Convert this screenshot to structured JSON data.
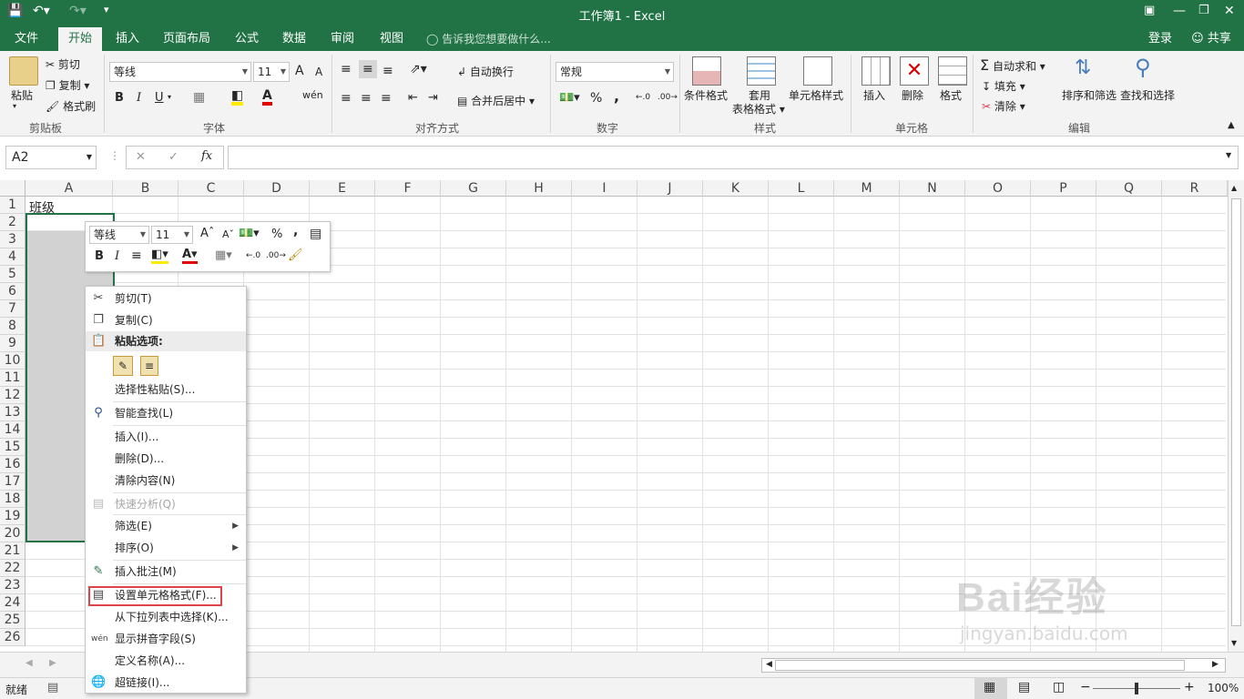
{
  "window": {
    "title": "工作簿1 - Excel"
  },
  "tabs": [
    {
      "label": "文件"
    },
    {
      "label": "开始"
    },
    {
      "label": "插入"
    },
    {
      "label": "页面布局"
    },
    {
      "label": "公式"
    },
    {
      "label": "数据"
    },
    {
      "label": "审阅"
    },
    {
      "label": "视图"
    }
  ],
  "tellme": "告诉我您想要做什么...",
  "login": "登录",
  "share": "共享",
  "ribbon": {
    "clipboard": {
      "paste": "粘贴",
      "cut": "剪切",
      "copy": "复制",
      "format_painter": "格式刷",
      "group": "剪贴板"
    },
    "font": {
      "name": "等线",
      "size": "11",
      "bold": "B",
      "italic": "I",
      "underline": "U",
      "group": "字体",
      "grow": "A",
      "shrink": "A"
    },
    "alignment": {
      "wrap": "自动换行",
      "merge": "合并后居中",
      "group": "对齐方式"
    },
    "number": {
      "format": "常规",
      "percent": "%",
      "comma": ",",
      "group": "数字"
    },
    "styles": {
      "conditional": "条件格式",
      "table1": "套用",
      "table2": "表格格式",
      "cell_styles": "单元格样式",
      "group": "样式"
    },
    "cells": {
      "insert": "插入",
      "delete": "删除",
      "format": "格式",
      "group": "单元格"
    },
    "editing": {
      "autosum": "自动求和",
      "fill": "填充",
      "clear": "清除",
      "sort": "排序和筛选",
      "find": "查找和选择",
      "group": "编辑"
    }
  },
  "formula_bar": {
    "name_box": "A2",
    "fx": "fx",
    "value": ""
  },
  "columns": [
    "A",
    "B",
    "C",
    "D",
    "E",
    "F",
    "G",
    "H",
    "I",
    "J",
    "K",
    "L",
    "M",
    "N",
    "O",
    "P",
    "Q",
    "R"
  ],
  "rows": [
    "1",
    "2",
    "3",
    "4",
    "5",
    "6",
    "7",
    "8",
    "9",
    "10",
    "11",
    "12",
    "13",
    "14",
    "15",
    "16",
    "17",
    "18",
    "19",
    "20",
    "21",
    "22",
    "23",
    "24",
    "25",
    "26"
  ],
  "cells": {
    "A1": "班级"
  },
  "mini_toolbar": {
    "font": "等线",
    "size": "11",
    "bold": "B",
    "italic": "I",
    "percent": "%",
    "comma": ","
  },
  "context_menu": {
    "cut": "剪切(T)",
    "copy": "复制(C)",
    "paste_options": "粘贴选项:",
    "paste_special": "选择性粘贴(S)...",
    "smart_lookup": "智能查找(L)",
    "insert": "插入(I)...",
    "delete": "删除(D)...",
    "clear": "清除内容(N)",
    "quick_analysis": "快速分析(Q)",
    "filter": "筛选(E)",
    "sort": "排序(O)",
    "insert_comment": "插入批注(M)",
    "format_cells": "设置单元格格式(F)...",
    "pick_list": "从下拉列表中选择(K)...",
    "phonetic": "显示拼音字段(S)",
    "define_name": "定义名称(A)...",
    "hyperlink": "超链接(I)..."
  },
  "status": {
    "ready": "就绪",
    "zoom": "100%"
  },
  "watermark": {
    "brand": "Bai经验",
    "url": "jingyan.baidu.com"
  },
  "colors": {
    "excel_green": "#217346",
    "highlight": "#e0424b",
    "selection": "#d2d2d2"
  }
}
